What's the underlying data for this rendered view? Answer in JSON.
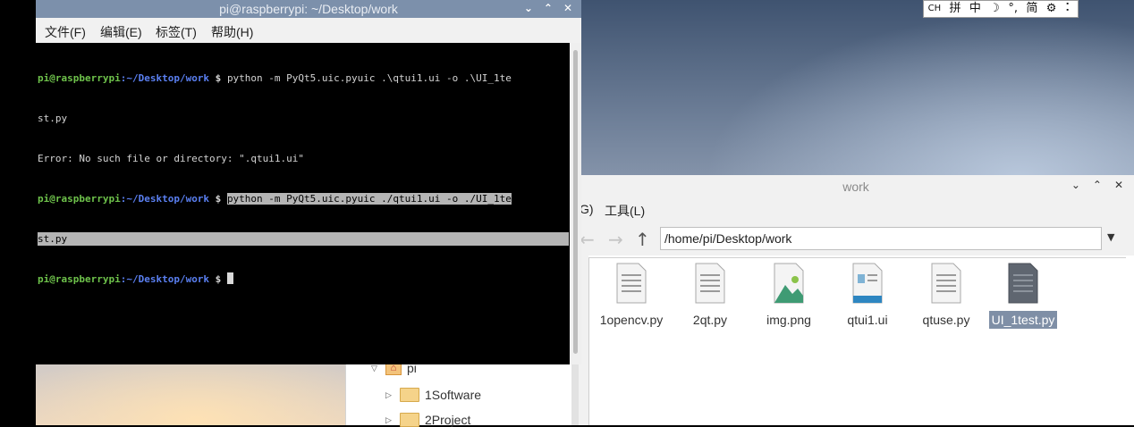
{
  "ime": {
    "items": [
      "CH",
      "拼",
      "中",
      "☽",
      "°,",
      "简",
      "⚙",
      "⠅"
    ]
  },
  "terminal": {
    "title": "pi@raspberrypi: ~/Desktop/work",
    "menu": [
      "文件(F)",
      "编辑(E)",
      "标签(T)",
      "帮助(H)"
    ],
    "prompt_user": "pi@raspberrypi",
    "prompt_path": ":~/Desktop/work",
    "prompt_dollar": " $ ",
    "cmd1_a": "python -m PyQt5.uic.pyuic .\\qtui1.ui -o .\\UI_1te",
    "cmd1_b": "st.py",
    "error": "Error: No such file or directory: \".qtui1.ui\"",
    "cmd2_a": "python -m PyQt5.uic.pyuic ./qtui1.ui -o ./UI_1te",
    "cmd2_b": "st.py"
  },
  "file_manager": {
    "title": "work",
    "menu": [
      "G)",
      "工具(L)"
    ],
    "path": "/home/pi/Desktop/work",
    "files": [
      {
        "name": "1opencv.py",
        "type": "text"
      },
      {
        "name": "2qt.py",
        "type": "text"
      },
      {
        "name": "img.png",
        "type": "image"
      },
      {
        "name": "qtui1.ui",
        "type": "ui"
      },
      {
        "name": "qtuse.py",
        "type": "text"
      },
      {
        "name": "UI_1test.py",
        "type": "text-dark",
        "selected": true
      }
    ],
    "tree": [
      "pi",
      "1Software",
      "2Project"
    ]
  },
  "colors": {
    "terminal_title_bar": "#7c90ab",
    "prompt_user": "#6ec24b",
    "prompt_path": "#5a7ff0",
    "selection": "#7f8fa6"
  }
}
